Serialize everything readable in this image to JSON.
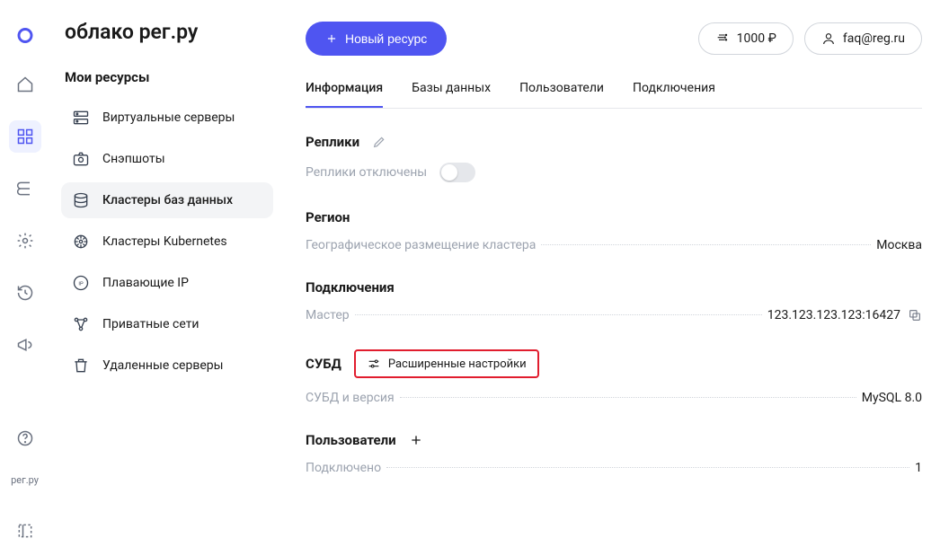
{
  "brand": "облако рег.ру",
  "topbar": {
    "new_resource_label": "Новый ресурс",
    "balance": "1000 ₽",
    "account": "faq@reg.ru"
  },
  "sidebar": {
    "section_title": "Мои ресурсы",
    "items": [
      {
        "label": "Виртуальные серверы"
      },
      {
        "label": "Снэпшоты"
      },
      {
        "label": "Кластеры баз данных"
      },
      {
        "label": "Кластеры Kubernetes"
      },
      {
        "label": "Плавающие IP"
      },
      {
        "label": "Приватные сети"
      },
      {
        "label": "Удаленные серверы"
      }
    ]
  },
  "rail": {
    "bottom_text": "рег.ру"
  },
  "tabs": [
    {
      "label": "Информация"
    },
    {
      "label": "Базы данных"
    },
    {
      "label": "Пользователи"
    },
    {
      "label": "Подключения"
    }
  ],
  "sections": {
    "replicas": {
      "title": "Реплики",
      "status": "Реплики отключены"
    },
    "region": {
      "title": "Регион",
      "key": "Географическое размещение кластера",
      "value": "Москва"
    },
    "connections": {
      "title": "Подключения",
      "key": "Мастер",
      "value": "123.123.123.123:16427"
    },
    "dbms": {
      "title": "СУБД",
      "advanced_label": "Расширенные настройки",
      "key": "СУБД и версия",
      "value": "MySQL 8.0"
    },
    "users": {
      "title": "Пользователи",
      "key": "Подключено",
      "value": "1"
    }
  }
}
